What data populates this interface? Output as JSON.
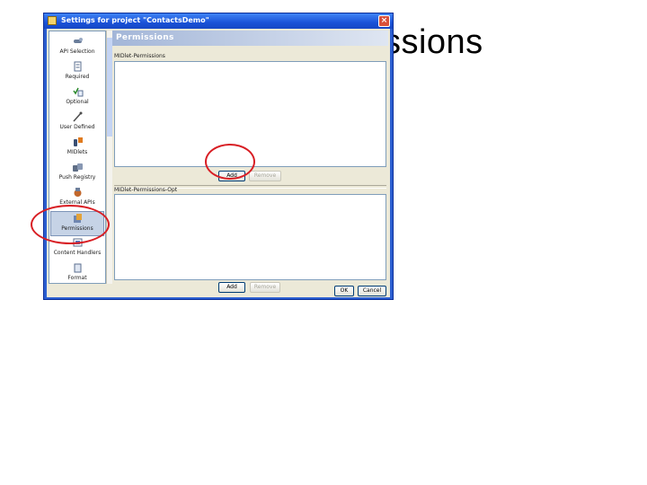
{
  "slide": {
    "title": "issions"
  },
  "window": {
    "title": "Settings for project \"ContactsDemo\"",
    "close": "×"
  },
  "sidebar": {
    "items": [
      {
        "label": "API Selection",
        "icon": "api-selection-icon"
      },
      {
        "label": "Required",
        "icon": "required-icon"
      },
      {
        "label": "Optional",
        "icon": "optional-icon"
      },
      {
        "label": "User Defined",
        "icon": "user-defined-icon"
      },
      {
        "label": "MIDlets",
        "icon": "midlets-icon"
      },
      {
        "label": "Push Registry",
        "icon": "push-registry-icon"
      },
      {
        "label": "External APIs",
        "icon": "external-apis-icon"
      },
      {
        "label": "Permissions",
        "icon": "permissions-icon",
        "selected": true
      },
      {
        "label": "Content Handlers",
        "icon": "content-handlers-icon"
      },
      {
        "label": "Format",
        "icon": "format-icon"
      }
    ]
  },
  "panel": {
    "title": "Permissions",
    "section1": {
      "label": "MIDlet-Permissions",
      "add": "Add",
      "remove": "Remove"
    },
    "section2": {
      "label": "MIDlet-Permissions-Opt",
      "add": "Add",
      "remove": "Remove"
    }
  },
  "footer": {
    "ok": "OK",
    "cancel": "Cancel"
  },
  "colors": {
    "annotation": "#d81e24",
    "titlebar": "#1a52d8",
    "panel_header": "#a3b6d8"
  }
}
